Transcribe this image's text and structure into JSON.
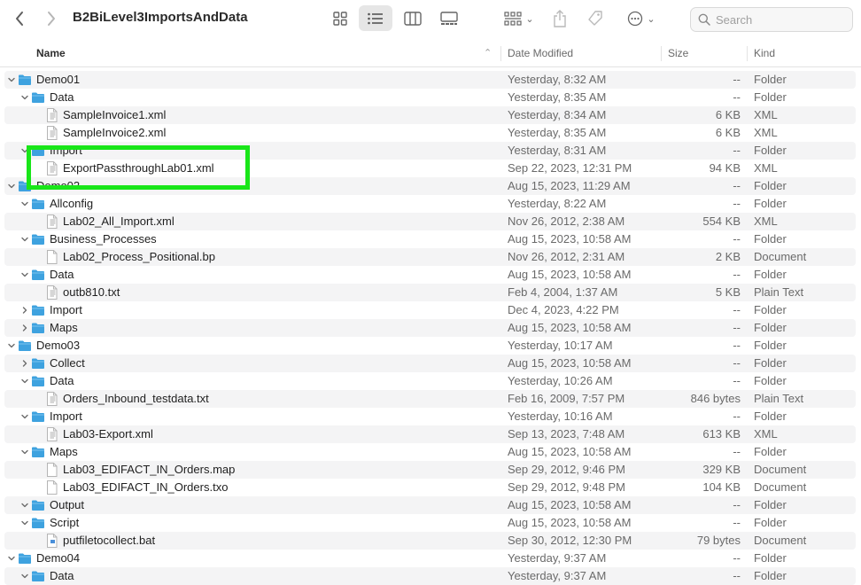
{
  "window": {
    "title": "B2BiLevel3ImportsAndData",
    "search_placeholder": "Search"
  },
  "toolbar_icons": [
    "back-icon",
    "forward-icon",
    "icon-view-icon",
    "list-view-icon",
    "column-view-icon",
    "gallery-view-icon",
    "group-icon",
    "share-icon",
    "tag-icon",
    "more-icon",
    "search-icon"
  ],
  "columns": {
    "name": "Name",
    "date": "Date Modified",
    "size": "Size",
    "kind": "Kind"
  },
  "colors": {
    "folder": "#3ea2df",
    "highlight": "#19e619",
    "row_alt": "#f4f4f5"
  },
  "rows": [
    {
      "name": "Demo01",
      "date": "Yesterday, 8:32 AM",
      "size": "--",
      "kind": "Folder",
      "level": 0,
      "type": "folder",
      "disc": "open"
    },
    {
      "name": "Data",
      "date": "Yesterday, 8:35 AM",
      "size": "--",
      "kind": "Folder",
      "level": 1,
      "type": "folder",
      "disc": "open"
    },
    {
      "name": "SampleInvoice1.xml",
      "date": "Yesterday, 8:34 AM",
      "size": "6 KB",
      "kind": "XML",
      "level": 2,
      "type": "xml"
    },
    {
      "name": "SampleInvoice2.xml",
      "date": "Yesterday, 8:35 AM",
      "size": "6 KB",
      "kind": "XML",
      "level": 2,
      "type": "xml"
    },
    {
      "name": "Import",
      "date": "Yesterday, 8:31 AM",
      "size": "--",
      "kind": "Folder",
      "level": 1,
      "type": "folder",
      "disc": "open"
    },
    {
      "name": "ExportPassthroughLab01.xml",
      "date": "Sep 22, 2023, 12:31 PM",
      "size": "94 KB",
      "kind": "XML",
      "level": 2,
      "type": "xml"
    },
    {
      "name": "Demo02",
      "date": "Aug 15, 2023, 11:29 AM",
      "size": "--",
      "kind": "Folder",
      "level": 0,
      "type": "folder",
      "disc": "open"
    },
    {
      "name": "Allconfig",
      "date": "Yesterday, 8:22 AM",
      "size": "--",
      "kind": "Folder",
      "level": 1,
      "type": "folder",
      "disc": "open"
    },
    {
      "name": "Lab02_All_Import.xml",
      "date": "Nov 26, 2012, 2:38 AM",
      "size": "554 KB",
      "kind": "XML",
      "level": 2,
      "type": "xml"
    },
    {
      "name": "Business_Processes",
      "date": "Aug 15, 2023, 10:58 AM",
      "size": "--",
      "kind": "Folder",
      "level": 1,
      "type": "folder",
      "disc": "open"
    },
    {
      "name": "Lab02_Process_Positional.bp",
      "date": "Nov 26, 2012, 2:31 AM",
      "size": "2 KB",
      "kind": "Document",
      "level": 2,
      "type": "doc"
    },
    {
      "name": "Data",
      "date": "Aug 15, 2023, 10:58 AM",
      "size": "--",
      "kind": "Folder",
      "level": 1,
      "type": "folder",
      "disc": "open"
    },
    {
      "name": "outb810.txt",
      "date": "Feb 4, 2004, 1:37 AM",
      "size": "5 KB",
      "kind": "Plain Text",
      "level": 2,
      "type": "txt"
    },
    {
      "name": "Import",
      "date": "Dec 4, 2023, 4:22 PM",
      "size": "--",
      "kind": "Folder",
      "level": 1,
      "type": "folder",
      "disc": "closed"
    },
    {
      "name": "Maps",
      "date": "Aug 15, 2023, 10:58 AM",
      "size": "--",
      "kind": "Folder",
      "level": 1,
      "type": "folder",
      "disc": "closed"
    },
    {
      "name": "Demo03",
      "date": "Yesterday, 10:17 AM",
      "size": "--",
      "kind": "Folder",
      "level": 0,
      "type": "folder",
      "disc": "open"
    },
    {
      "name": "Collect",
      "date": "Aug 15, 2023, 10:58 AM",
      "size": "--",
      "kind": "Folder",
      "level": 1,
      "type": "folder",
      "disc": "closed"
    },
    {
      "name": "Data",
      "date": "Yesterday, 10:26 AM",
      "size": "--",
      "kind": "Folder",
      "level": 1,
      "type": "folder",
      "disc": "open"
    },
    {
      "name": "Orders_Inbound_testdata.txt",
      "date": "Feb 16, 2009, 7:57 PM",
      "size": "846 bytes",
      "kind": "Plain Text",
      "level": 2,
      "type": "txt"
    },
    {
      "name": "Import",
      "date": "Yesterday, 10:16 AM",
      "size": "--",
      "kind": "Folder",
      "level": 1,
      "type": "folder",
      "disc": "open"
    },
    {
      "name": "Lab03-Export.xml",
      "date": "Sep 13, 2023, 7:48 AM",
      "size": "613 KB",
      "kind": "XML",
      "level": 2,
      "type": "xml"
    },
    {
      "name": "Maps",
      "date": "Aug 15, 2023, 10:58 AM",
      "size": "--",
      "kind": "Folder",
      "level": 1,
      "type": "folder",
      "disc": "open"
    },
    {
      "name": "Lab03_EDIFACT_IN_Orders.map",
      "date": "Sep 29, 2012, 9:46 PM",
      "size": "329 KB",
      "kind": "Document",
      "level": 2,
      "type": "doc"
    },
    {
      "name": "Lab03_EDIFACT_IN_Orders.txo",
      "date": "Sep 29, 2012, 9:48 PM",
      "size": "104 KB",
      "kind": "Document",
      "level": 2,
      "type": "doc"
    },
    {
      "name": "Output",
      "date": "Aug 15, 2023, 10:58 AM",
      "size": "--",
      "kind": "Folder",
      "level": 1,
      "type": "folder",
      "disc": "open"
    },
    {
      "name": "Script",
      "date": "Aug 15, 2023, 10:58 AM",
      "size": "--",
      "kind": "Folder",
      "level": 1,
      "type": "folder",
      "disc": "open"
    },
    {
      "name": "putfiletocollect.bat",
      "date": "Sep 30, 2012, 12:30 PM",
      "size": "79 bytes",
      "kind": "Document",
      "level": 2,
      "type": "bat"
    },
    {
      "name": "Demo04",
      "date": "Yesterday, 9:37 AM",
      "size": "--",
      "kind": "Folder",
      "level": 0,
      "type": "folder",
      "disc": "open"
    },
    {
      "name": "Data",
      "date": "Yesterday, 9:37 AM",
      "size": "--",
      "kind": "Folder",
      "level": 1,
      "type": "folder",
      "disc": "open"
    }
  ]
}
